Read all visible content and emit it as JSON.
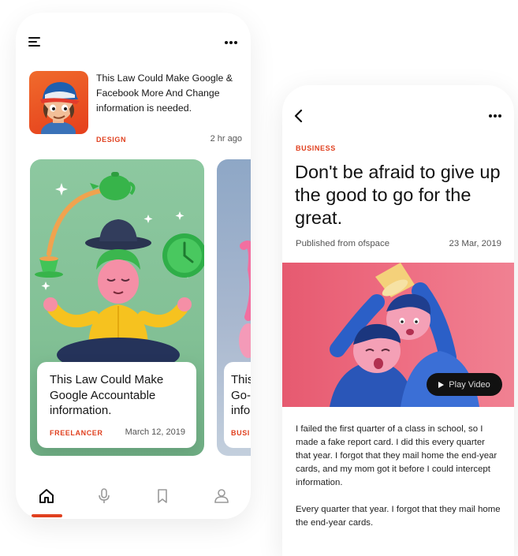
{
  "feed": {
    "featured": {
      "title": "This Law Could Make Google & Facebook More And Change information is needed.",
      "category": "DESIGN",
      "time": "2 hr ago"
    },
    "cards": [
      {
        "title": "This Law Could Make Google Accountable information.",
        "category": "FREELANCER",
        "date": "March 12, 2019"
      },
      {
        "title_lines": [
          "This",
          "Go-",
          "info"
        ],
        "category": "BUSI"
      }
    ],
    "tabs": [
      "home",
      "microphone",
      "bookmark",
      "profile"
    ],
    "colors": {
      "accent": "#e0401f",
      "card_green": "#8dc8a0"
    }
  },
  "article": {
    "category": "BUSINESS",
    "headline": "Don't be afraid to give up the good to go for the great.",
    "publisher": "Published from ofspace",
    "date": "23 Mar, 2019",
    "video_label": "Play Video",
    "paragraphs": [
      "I failed the first quarter of a class in school, so I made a fake report card. I did this every quarter that year. I forgot that they mail home the end-year cards, and my mom got it before I could intercept information.",
      "Every quarter that year. I forgot that they mail home the end-year cards."
    ],
    "colors": {
      "hero_pink": "#ee6d82"
    }
  }
}
